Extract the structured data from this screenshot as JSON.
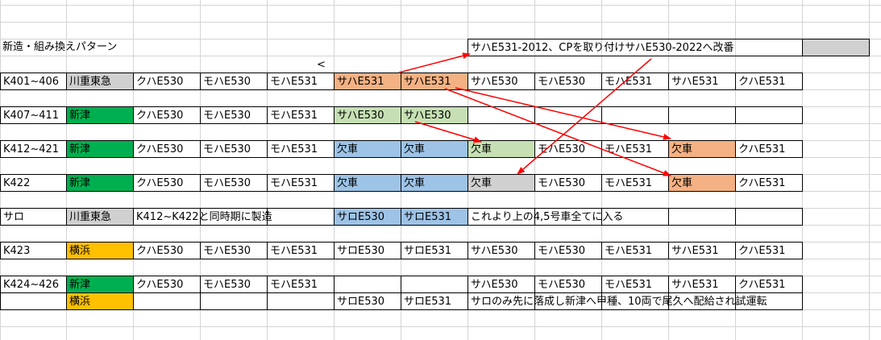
{
  "title": "新造・組み換えパターン",
  "stray_mark": "<",
  "note_top": "サハE531-2012、CPを取り付けサハE530-2022へ改番",
  "colors": {
    "green": "#00b050",
    "gray": "#d0d0d0",
    "orange": "#f4b183",
    "light_green": "#c6e0b4",
    "blue": "#9dc3e6",
    "yellow": "#ffc000",
    "arrow": "#ff0000"
  },
  "rows": [
    {
      "cells": [
        "K401~406",
        "川重東急",
        "クハE530",
        "モハE530",
        "モハE531",
        "サハE531",
        "サハE531",
        "サハE530",
        "モハE530",
        "モハE531",
        "サハE531",
        "クハE531"
      ],
      "fills": [
        null,
        "gray",
        null,
        null,
        null,
        "orange",
        "orange",
        null,
        null,
        null,
        null,
        null
      ]
    },
    {
      "cells": [
        "K407~411",
        "新津",
        "クハE530",
        "モハE530",
        "モハE531",
        "サハE530",
        "サハE530",
        "",
        "",
        "",
        "",
        ""
      ],
      "fills": [
        null,
        "green",
        null,
        null,
        null,
        "light_green",
        "light_green",
        null,
        null,
        null,
        null,
        null
      ]
    },
    {
      "cells": [
        "K412~421",
        "新津",
        "クハE530",
        "モハE530",
        "モハE531",
        "欠車",
        "欠車",
        "欠車",
        "モハE530",
        "モハE531",
        "欠車",
        "クハE531"
      ],
      "fills": [
        null,
        "green",
        null,
        null,
        null,
        "blue",
        "blue",
        "light_green",
        null,
        null,
        "orange",
        null
      ]
    },
    {
      "cells": [
        "K422",
        "新津",
        "クハE530",
        "モハE530",
        "モハE531",
        "欠車",
        "欠車",
        "欠車",
        "モハE530",
        "モハE531",
        "欠車",
        "クハE531"
      ],
      "fills": [
        null,
        "green",
        null,
        null,
        null,
        "blue",
        "blue",
        "gray",
        null,
        null,
        "orange",
        null
      ]
    },
    {
      "cells": [
        "サロ",
        "川重東急",
        "K412~K422と同時期に製造",
        "",
        "",
        "サロE530",
        "サロE531",
        "これより上の4,5号車全てに入る",
        "",
        "",
        "",
        ""
      ],
      "fills": [
        null,
        "gray",
        null,
        null,
        null,
        "blue",
        "blue",
        null,
        null,
        null,
        null,
        null
      ]
    },
    {
      "cells": [
        "K423",
        "横浜",
        "クハE530",
        "モハE530",
        "モハE531",
        "サロE530",
        "サロE531",
        "サハE530",
        "モハE530",
        "モハE531",
        "サハE531",
        "クハE531"
      ],
      "fills": [
        null,
        "yellow",
        null,
        null,
        null,
        null,
        null,
        null,
        null,
        null,
        null,
        null
      ]
    },
    {
      "cells": [
        "K424~426",
        "新津",
        "クハE530",
        "モハE530",
        "モハE531",
        "",
        "",
        "サハE530",
        "モハE530",
        "モハE531",
        "サハE531",
        "クハE531"
      ],
      "fills": [
        null,
        "green",
        null,
        null,
        null,
        null,
        null,
        null,
        null,
        null,
        null,
        null
      ]
    },
    {
      "cells": [
        "",
        "横浜",
        "",
        "",
        "",
        "サロE530",
        "サロE531",
        "サロのみ先に落成し新津へ甲種、10両で尾久へ配給され試運転",
        "",
        "",
        "",
        ""
      ],
      "fills": [
        null,
        "yellow",
        null,
        null,
        null,
        null,
        null,
        null,
        null,
        null,
        null,
        null
      ]
    }
  ]
}
